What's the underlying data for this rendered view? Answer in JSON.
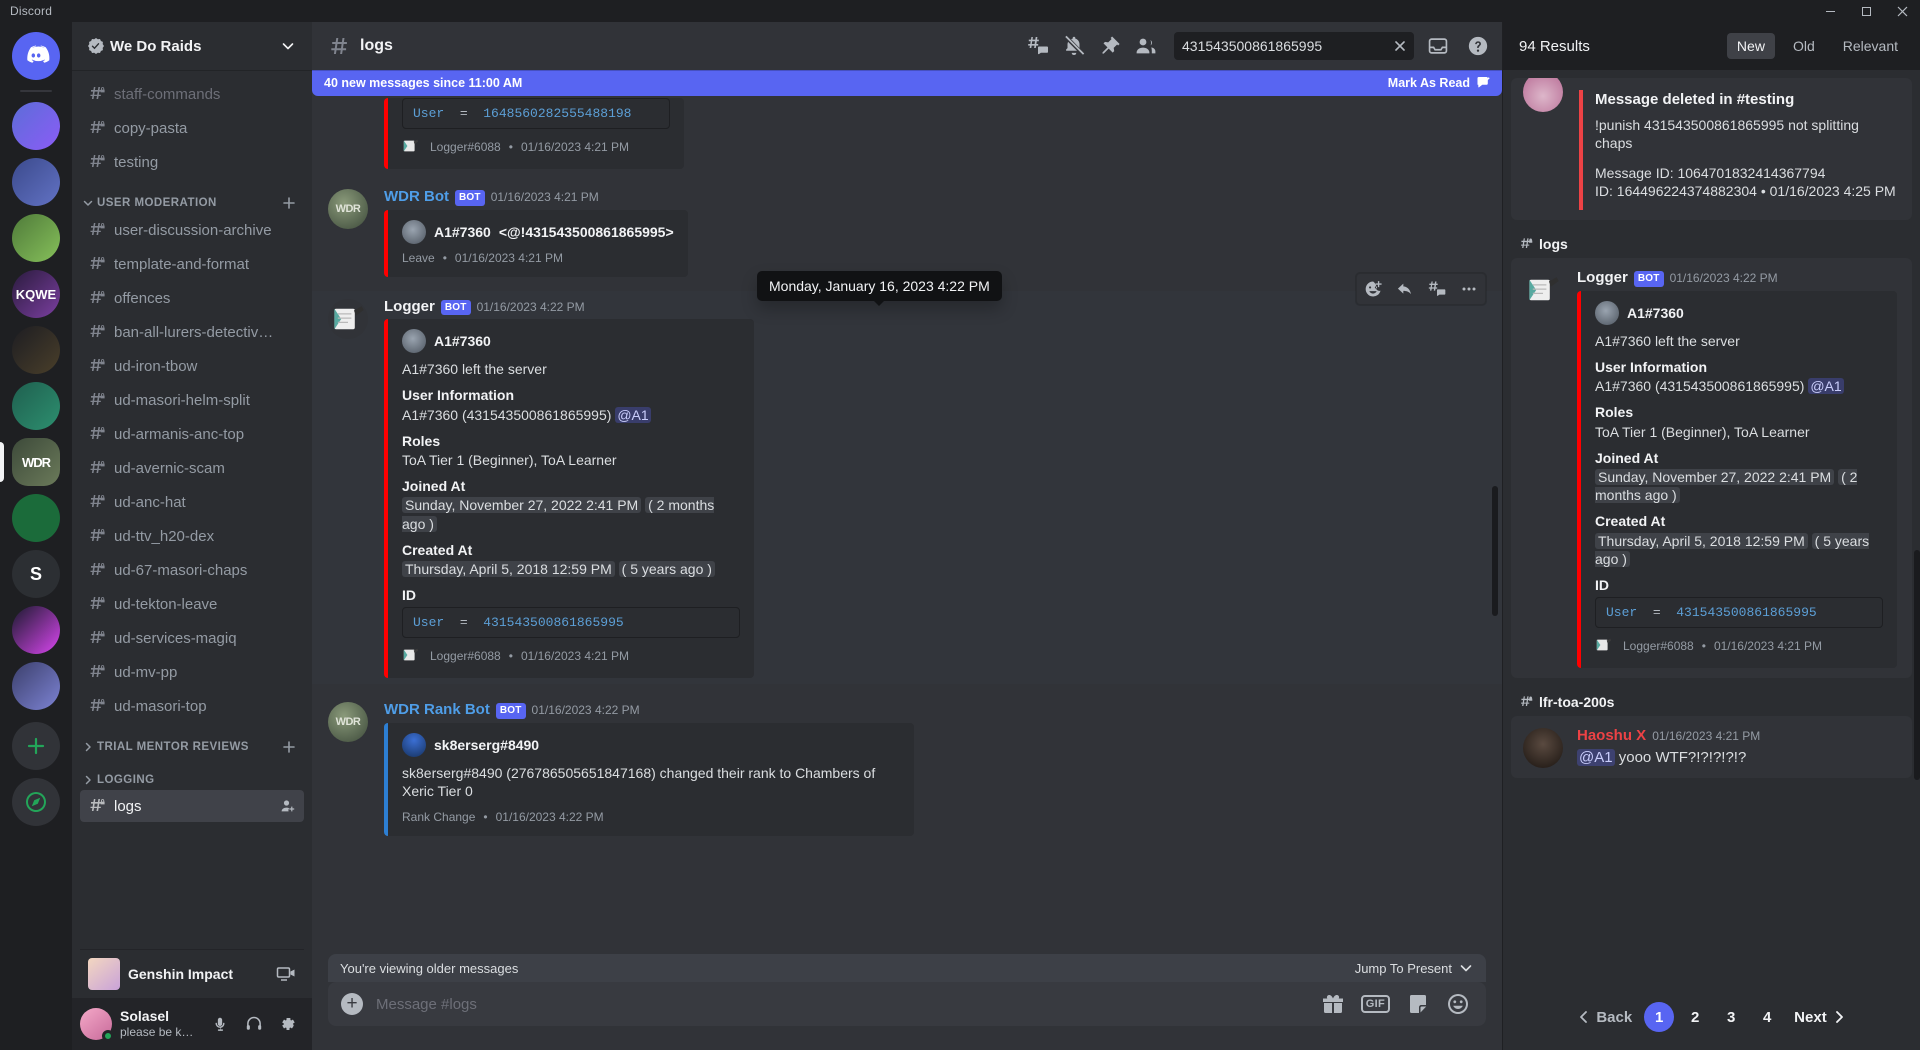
{
  "window": {
    "app_title": "Discord",
    "minimize": "–",
    "maximize": "▭",
    "close": "✕"
  },
  "server_rail": {
    "items": [
      {
        "name": "discord-home",
        "label": "",
        "color": "#5865f2"
      },
      {
        "name": "server-1",
        "label": "",
        "color": "#5c6dd8"
      },
      {
        "name": "server-2",
        "label": "",
        "color": "#3b4a8c"
      },
      {
        "name": "server-3",
        "label": "",
        "color": "#4f7a3a"
      },
      {
        "name": "server-4-kqwe",
        "label": "",
        "color": "#2a1b3d"
      },
      {
        "name": "server-5",
        "label": "",
        "color": "#2c2f33"
      },
      {
        "name": "server-6",
        "label": "",
        "color": "#1f5f4f"
      },
      {
        "name": "server-wdr",
        "label": "WDR",
        "color": "#3d4a3a"
      },
      {
        "name": "server-7",
        "label": "",
        "color": "#1b6b3a"
      },
      {
        "name": "server-8-s",
        "label": "S",
        "color": "#2c2f33"
      },
      {
        "name": "server-9",
        "label": "",
        "color": "#1a1a2e"
      },
      {
        "name": "server-10",
        "label": "",
        "color": "#3b3f6b"
      }
    ],
    "add_server_label": "+",
    "explore_label": "⦿"
  },
  "sidebar": {
    "guild_name": "We Do Raids",
    "groups": [
      {
        "name": "ungrouped",
        "title": null,
        "collapsed": false,
        "channels": [
          {
            "label": "staff-commands",
            "locked": true,
            "muted": true,
            "active": false
          },
          {
            "label": "copy-pasta",
            "locked": true,
            "muted": false,
            "active": false
          },
          {
            "label": "testing",
            "locked": true,
            "muted": false,
            "active": false
          }
        ]
      },
      {
        "name": "user-moderation",
        "title": "USER MODERATION",
        "collapsed": false,
        "has_add": true,
        "channels": [
          {
            "label": "user-discussion-archive",
            "locked": true,
            "muted": false,
            "active": false
          },
          {
            "label": "template-and-format",
            "locked": true,
            "muted": false,
            "active": false
          },
          {
            "label": "offences",
            "locked": true,
            "muted": false,
            "active": false
          },
          {
            "label": "ban-all-lurers-detectiv…",
            "locked": true,
            "muted": false,
            "active": false
          },
          {
            "label": "ud-iron-tbow",
            "locked": true,
            "muted": false,
            "active": false
          },
          {
            "label": "ud-masori-helm-split",
            "locked": true,
            "muted": false,
            "active": false
          },
          {
            "label": "ud-armanis-anc-top",
            "locked": true,
            "muted": false,
            "active": false
          },
          {
            "label": "ud-avernic-scam",
            "locked": true,
            "muted": false,
            "active": false
          },
          {
            "label": "ud-anc-hat",
            "locked": true,
            "muted": false,
            "active": false
          },
          {
            "label": "ud-ttv_h20-dex",
            "locked": true,
            "muted": false,
            "active": false
          },
          {
            "label": "ud-67-masori-chaps",
            "locked": true,
            "muted": false,
            "active": false
          },
          {
            "label": "ud-tekton-leave",
            "locked": true,
            "muted": false,
            "active": false
          },
          {
            "label": "ud-services-magiq",
            "locked": true,
            "muted": false,
            "active": false
          },
          {
            "label": "ud-mv-pp",
            "locked": true,
            "muted": false,
            "active": false
          },
          {
            "label": "ud-masori-top",
            "locked": true,
            "muted": false,
            "active": false
          }
        ]
      },
      {
        "name": "trial-mentor-reviews",
        "title": "TRIAL MENTOR REVIEWS",
        "collapsed": true,
        "has_add": true,
        "channels": []
      },
      {
        "name": "logging",
        "title": "LOGGING",
        "collapsed": true,
        "has_add": false,
        "channels": [
          {
            "label": "logs",
            "locked": true,
            "muted": false,
            "active": true,
            "action_icon": "add-member-icon"
          }
        ]
      }
    ],
    "activity": {
      "name": "Genshin Impact",
      "icon": "game-avatar",
      "stream_icon": "screen-share-icon"
    },
    "user": {
      "name": "Solasel",
      "status_text": "please be kin...",
      "status": "online",
      "controls": [
        "mic-icon",
        "headphones-icon",
        "settings-gear-icon"
      ]
    }
  },
  "channel_header": {
    "channel_name": "logs",
    "icons": [
      "threads-icon",
      "notification-off-icon",
      "pinned-messages-icon",
      "member-list-icon"
    ],
    "search_value": "431543500861865995",
    "search_placeholder": "Search",
    "right_icons": [
      "inbox-icon",
      "help-icon"
    ]
  },
  "new_messages_bar": {
    "text": "40 new messages since 11:00 AM",
    "mark_as_read": "Mark As Read"
  },
  "messages": [
    {
      "id": "msg-partial-top",
      "partial": true,
      "code_key": "User",
      "code_eq": "=",
      "code_value": "1648560282555488198",
      "footer_author": "Logger#6088",
      "footer_sep": "•",
      "footer_ts": "01/16/2023 4:21 PM"
    },
    {
      "id": "msg-wdr-bot",
      "author": "WDR Bot",
      "author_color": "#4f9ee8",
      "bot_tag": "BOT",
      "timestamp": "01/16/2023 4:21 PM",
      "embed_color": "#ff0000",
      "embed_author_name": "A1#7360",
      "embed_author_extra": "<@!431543500861865995>",
      "footer_label": "Leave",
      "footer_sep": "•",
      "footer_ts": "01/16/2023 4:21 PM"
    },
    {
      "id": "msg-logger",
      "author": "Logger",
      "author_color": "#f2f3f5",
      "bot_tag": "BOT",
      "timestamp": "01/16/2023 4:22 PM",
      "embed_color": "#ff0000",
      "embed_author_name": "A1#7360",
      "embed_description": "A1#7360 left the server",
      "fields": [
        {
          "name": "User Information",
          "value": "A1#7360 (431543500861865995)",
          "mention": "@A1"
        },
        {
          "name": "Roles",
          "value": "ToA Tier 1 (Beginner), ToA Learner"
        },
        {
          "name": "Joined At",
          "value_ts": "Sunday, November 27, 2022 2:41 PM",
          "value_rel": "( 2 months ago )"
        },
        {
          "name": "Created At",
          "value_ts": "Thursday, April 5, 2018 12:59 PM",
          "value_rel": "( 5 years ago )"
        },
        {
          "name": "ID",
          "code_key": "User",
          "code_eq": "=",
          "code_value": "431543500861865995"
        }
      ],
      "footer_author": "Logger#6088",
      "footer_sep": "•",
      "footer_ts": "01/16/2023 4:21 PM"
    },
    {
      "id": "msg-rank-bot",
      "author": "WDR Rank Bot",
      "author_color": "#4f9ee8",
      "bot_tag": "BOT",
      "timestamp": "01/16/2023 4:22 PM",
      "embed_color": "#2d7fd3",
      "embed_author_name": "sk8erserg#8490",
      "embed_description": "sk8erserg#8490 (276786505651847168) changed their rank to Chambers of Xeric Tier 0",
      "footer_label": "Rank Change",
      "footer_sep": "•",
      "footer_ts": "01/16/2023 4:22 PM"
    }
  ],
  "tooltip": {
    "text": "Monday, January 16, 2023 4:22 PM"
  },
  "message_toolbar": {
    "buttons": [
      "add-reaction-icon",
      "reply-icon",
      "create-thread-icon",
      "more-actions-icon"
    ]
  },
  "jump_bar": {
    "text": "You're viewing older messages",
    "jump_label": "Jump To Present"
  },
  "composer": {
    "placeholder": "Message #logs",
    "icons": [
      "gift-icon",
      "GIF",
      "sticker-icon",
      "emoji-icon"
    ]
  },
  "search_panel": {
    "results_count": "94 Results",
    "tabs": [
      {
        "label": "New",
        "active": true
      },
      {
        "label": "Old",
        "active": false
      },
      {
        "label": "Relevant",
        "active": false
      }
    ],
    "groups": [
      {
        "channel": null,
        "results": [
          {
            "id": "res-deleted",
            "embed_color": "#ed4245",
            "embed_title": "Message deleted in #testing",
            "embed_desc": "!punish 431543500861865995 not splitting chaps",
            "meta_line1": "Message ID: 1064701832414367794",
            "meta_line2": "ID: 164496224374882304",
            "meta_sep": "•",
            "meta_ts": "01/16/2023 4:25 PM"
          }
        ]
      },
      {
        "channel": "logs",
        "results": [
          {
            "id": "res-logger",
            "author": "Logger",
            "bot_tag": "BOT",
            "timestamp": "01/16/2023 4:22 PM",
            "embed_color": "#ff0000",
            "embed_author_name": "A1#7360",
            "embed_description": "A1#7360 left the server",
            "fields": [
              {
                "name": "User Information",
                "value": "A1#7360 (431543500861865995)",
                "mention": "@A1"
              },
              {
                "name": "Roles",
                "value": "ToA Tier 1 (Beginner), ToA Learner"
              },
              {
                "name": "Joined At",
                "value_ts": "Sunday, November 27, 2022 2:41 PM",
                "value_rel": "( 2 months ago )"
              },
              {
                "name": "Created At",
                "value_ts": "Thursday, April 5, 2018 12:59 PM",
                "value_rel": "( 5 years ago )"
              },
              {
                "name": "ID",
                "code_key": "User",
                "code_eq": "=",
                "code_value": "431543500861865995"
              }
            ],
            "footer_author": "Logger#6088",
            "footer_sep": "•",
            "footer_ts": "01/16/2023 4:21 PM"
          }
        ]
      },
      {
        "channel": "lfr-toa-200s",
        "results": [
          {
            "id": "res-haoshu",
            "author": "Haoshu X",
            "author_color": "#ed4245",
            "timestamp": "01/16/2023 4:21 PM",
            "mention": "@A1",
            "text": " yooo WTF?!?!?!?!?"
          }
        ]
      }
    ],
    "pagination": {
      "back": "Back",
      "pages": [
        "1",
        "2",
        "3",
        "4"
      ],
      "active_page": "1",
      "next": "Next"
    }
  }
}
